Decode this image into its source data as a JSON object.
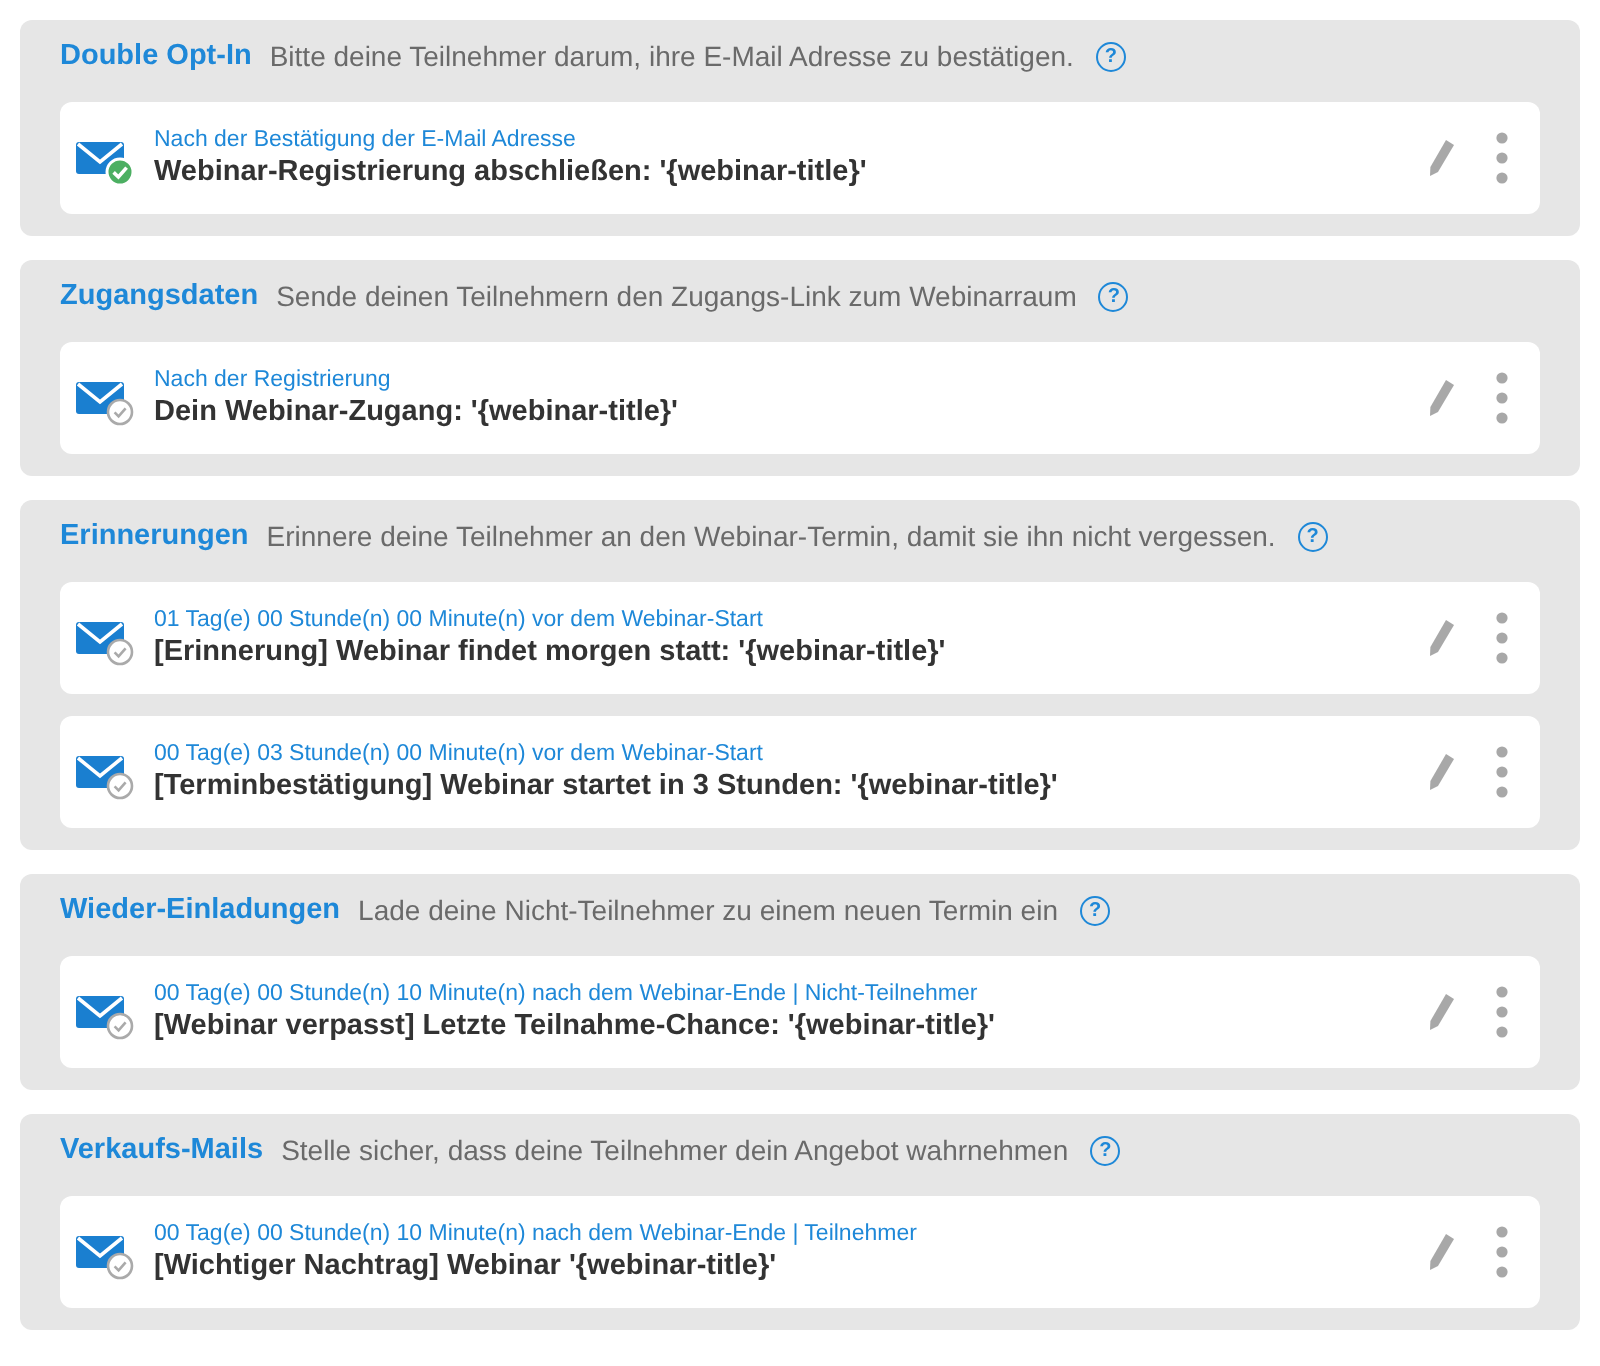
{
  "sections": [
    {
      "title": "Double Opt-In",
      "description": "Bitte deine Teilnehmer darum, ihre E-Mail Adresse zu bestätigen.",
      "help": "?",
      "mails": [
        {
          "timing": "Nach der Bestätigung der E-Mail Adresse",
          "subject": "Webinar-Registrierung abschließen: '{webinar-title}'",
          "active": true
        }
      ]
    },
    {
      "title": "Zugangsdaten",
      "description": "Sende deinen Teilnehmern den Zugangs-Link zum Webinarraum",
      "help": "?",
      "mails": [
        {
          "timing": "Nach der Registrierung",
          "subject": "Dein Webinar-Zugang: '{webinar-title}'",
          "active": false
        }
      ]
    },
    {
      "title": "Erinnerungen",
      "description": "Erinnere deine Teilnehmer an den Webinar-Termin, damit sie ihn nicht vergessen.",
      "help": "?",
      "mails": [
        {
          "timing": "01 Tag(e) 00 Stunde(n) 00 Minute(n) vor dem Webinar-Start",
          "subject": "[Erinnerung] Webinar findet morgen statt: '{webinar-title}'",
          "active": false
        },
        {
          "timing": "00 Tag(e) 03 Stunde(n) 00 Minute(n) vor dem Webinar-Start",
          "subject": "[Terminbestätigung] Webinar startet in 3 Stunden: '{webinar-title}'",
          "active": false
        }
      ]
    },
    {
      "title": "Wieder-Einladungen",
      "description": "Lade deine Nicht-Teilnehmer zu einem neuen Termin ein",
      "help": "?",
      "mails": [
        {
          "timing": "00 Tag(e) 00 Stunde(n) 10 Minute(n) nach dem Webinar-Ende | Nicht-Teilnehmer",
          "subject": "[Webinar verpasst] Letzte Teilnahme-Chance: '{webinar-title}'",
          "active": false
        }
      ]
    },
    {
      "title": "Verkaufs-Mails",
      "description": "Stelle sicher, dass deine Teilnehmer dein Angebot wahrnehmen",
      "help": "?",
      "mails": [
        {
          "timing": "00 Tag(e) 00 Stunde(n) 10 Minute(n) nach dem Webinar-Ende | Teilnehmer",
          "subject": "[Wichtiger Nachtrag] Webinar '{webinar-title}'",
          "active": false
        }
      ]
    }
  ]
}
